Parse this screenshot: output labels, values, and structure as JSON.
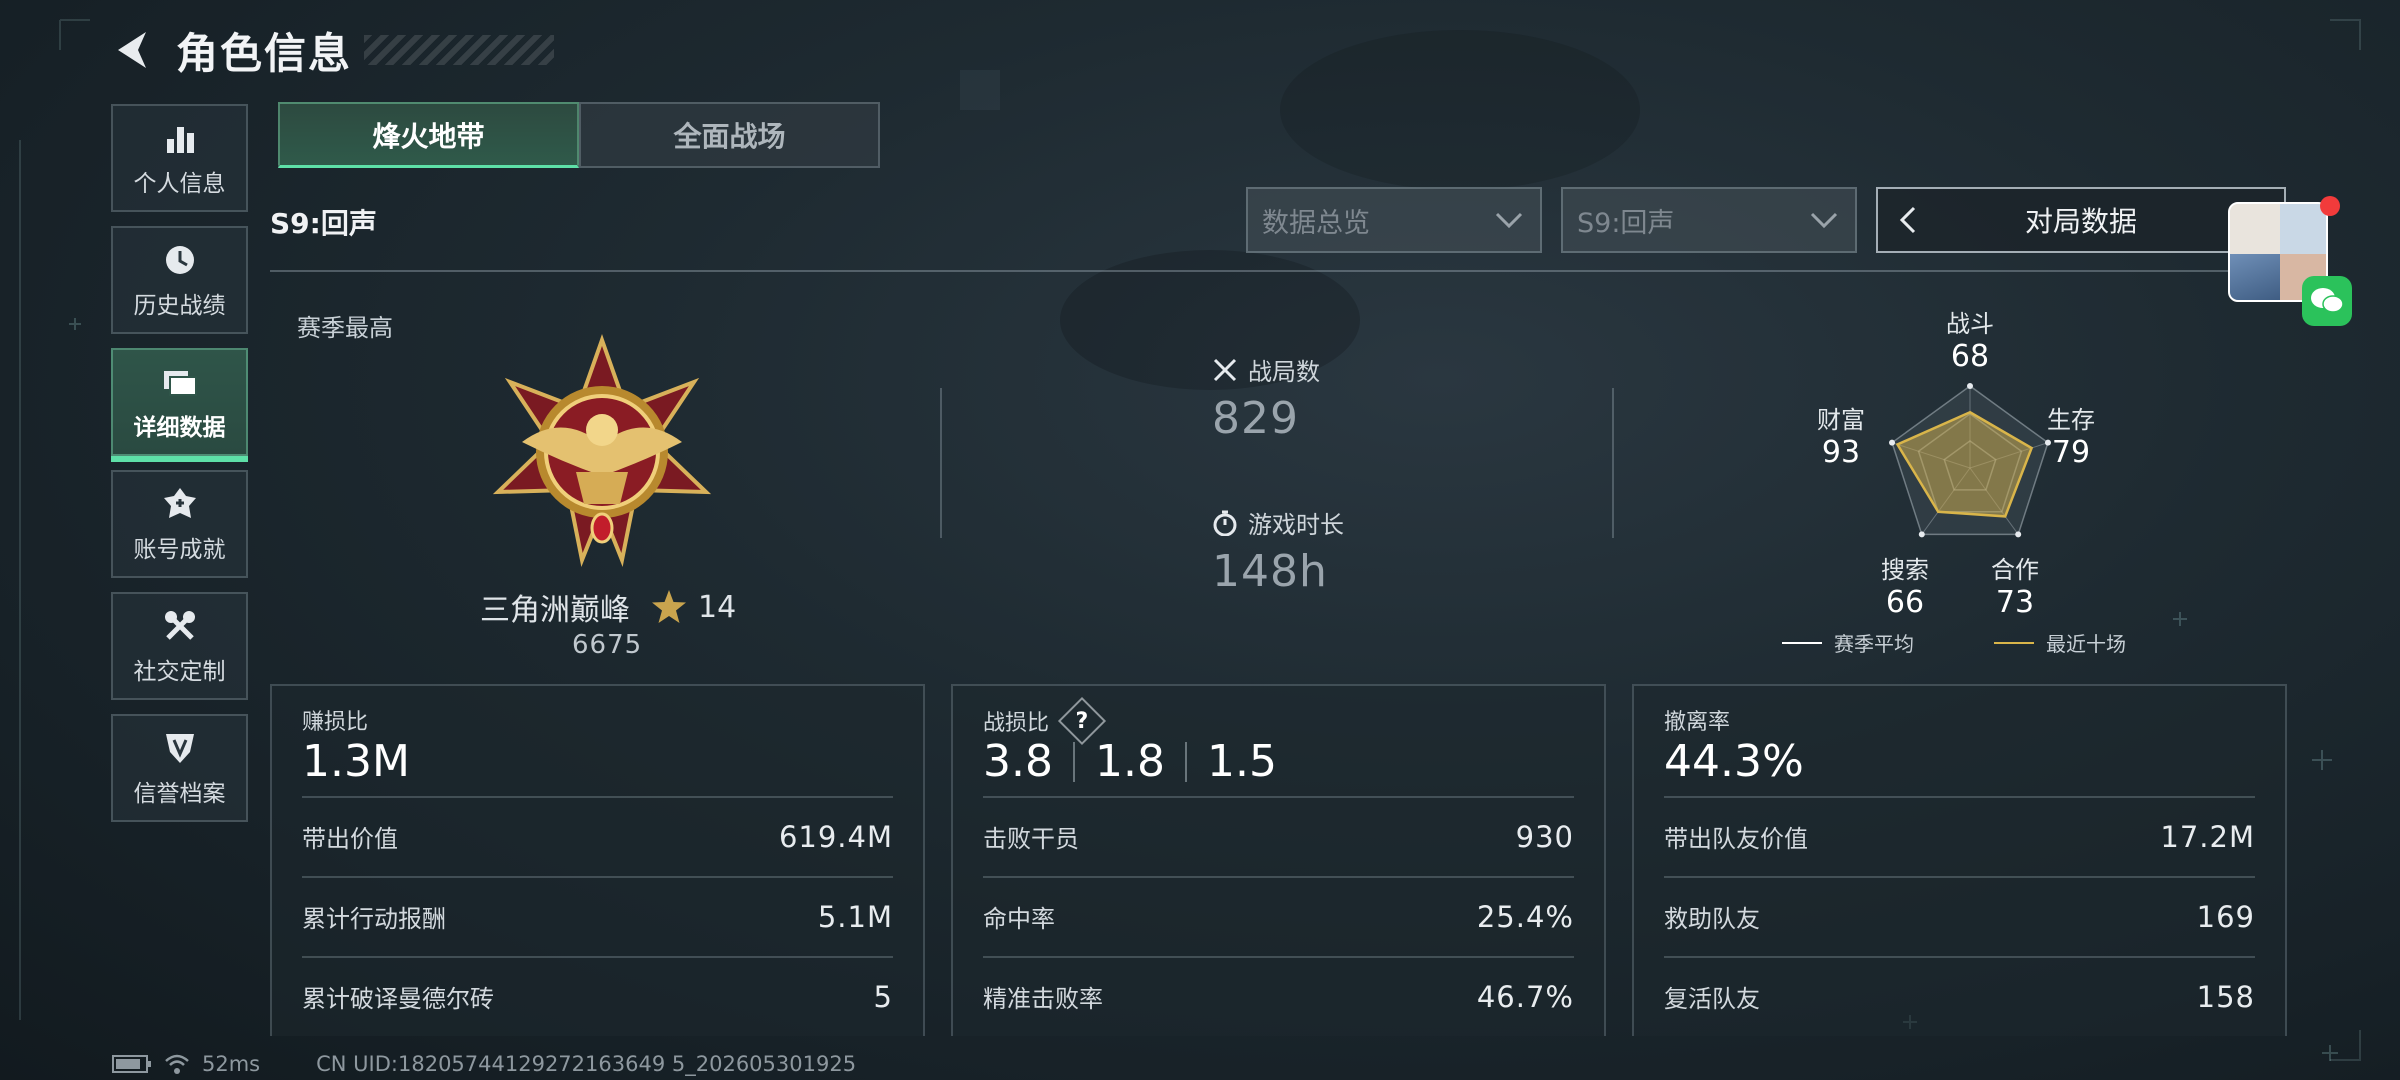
{
  "header": {
    "title": "角色信息"
  },
  "sidebar": {
    "items": [
      {
        "label": "个人信息",
        "icon": "bar-chart-icon"
      },
      {
        "label": "历史战绩",
        "icon": "clock-history-icon"
      },
      {
        "label": "详细数据",
        "icon": "folder-icon",
        "active": true
      },
      {
        "label": "账号成就",
        "icon": "medal-icon"
      },
      {
        "label": "社交定制",
        "icon": "tools-icon"
      },
      {
        "label": "信誉档案",
        "icon": "shield-icon"
      }
    ]
  },
  "mode_tabs": [
    {
      "label": "烽火地带",
      "active": true
    },
    {
      "label": "全面战场",
      "active": false
    }
  ],
  "season_label": "S9:回声",
  "filters": {
    "overview": "数据总览",
    "season": "S9:回声",
    "match_data": "对局数据"
  },
  "profile": {
    "season_high_label": "赛季最高",
    "rank_name": "三角洲巅峰",
    "rank_stars": "14",
    "rank_score": "6675"
  },
  "summary": {
    "battles_label": "战局数",
    "battles_value": "829",
    "playtime_label": "游戏时长",
    "playtime_value": "148h"
  },
  "radar": {
    "axes": [
      {
        "label": "战斗",
        "value": "68"
      },
      {
        "label": "生存",
        "value": "79"
      },
      {
        "label": "合作",
        "value": "73"
      },
      {
        "label": "搜索",
        "value": "66"
      },
      {
        "label": "财富",
        "value": "93"
      }
    ],
    "legend_season_avg": "赛季平均",
    "legend_recent": "最近十场",
    "colors": {
      "season_avg": "#ffffff",
      "recent": "#d9b54a"
    }
  },
  "panels": {
    "profit": {
      "title": "赚损比",
      "big": "1.3M",
      "rows": [
        {
          "k": "带出价值",
          "v": "619.4M"
        },
        {
          "k": "累计行动报酬",
          "v": "5.1M"
        },
        {
          "k": "累计破译曼德尔砖",
          "v": "5"
        }
      ]
    },
    "kd": {
      "title": "战损比",
      "help": "?",
      "big": [
        "3.8",
        "1.8",
        "1.5"
      ],
      "rows": [
        {
          "k": "击败干员",
          "v": "930"
        },
        {
          "k": "命中率",
          "v": "25.4%"
        },
        {
          "k": "精准击败率",
          "v": "46.7%"
        }
      ]
    },
    "extract": {
      "title": "撤离率",
      "big": "44.3%",
      "rows": [
        {
          "k": "带出队友价值",
          "v": "17.2M"
        },
        {
          "k": "救助队友",
          "v": "169"
        },
        {
          "k": "复活队友",
          "v": "158"
        }
      ]
    }
  },
  "footer": {
    "ping": "52ms",
    "uid": "CN UID:18205744129272163649 5_202605301925"
  },
  "accent": "#5ee0a8"
}
